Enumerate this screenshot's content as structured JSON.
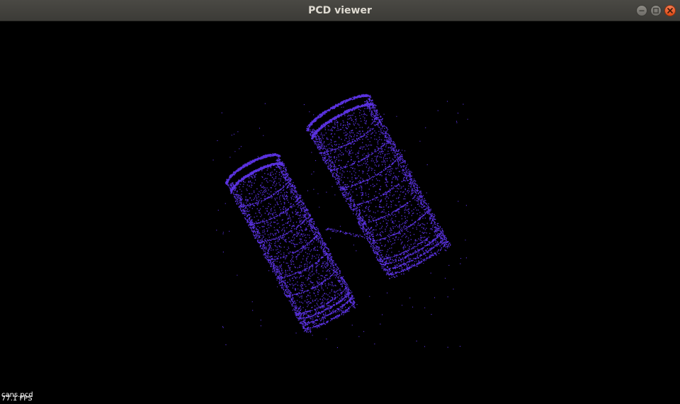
{
  "window": {
    "title": "PCD viewer",
    "controls": {
      "minimize_icon": "minimize-icon",
      "maximize_icon": "maximize-icon",
      "close_icon": "close-icon"
    }
  },
  "viewport": {
    "background": "#000000",
    "point_color": "#5a32e0",
    "overlay": {
      "filename": "cans.pcd",
      "fps": "77.1 FPS"
    }
  }
}
